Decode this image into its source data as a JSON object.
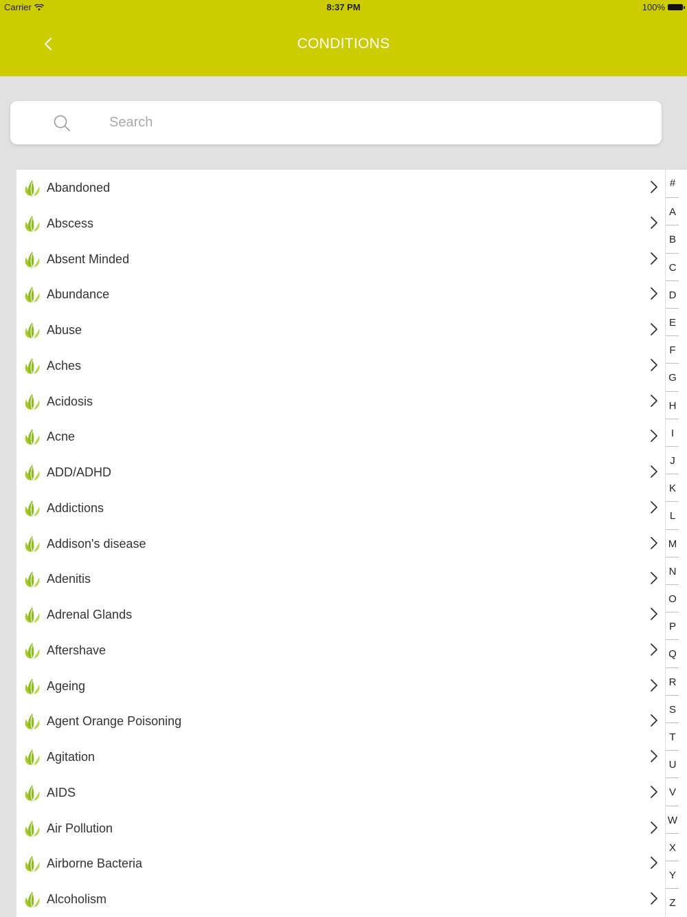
{
  "status_bar": {
    "carrier": "Carrier",
    "time": "8:37 PM",
    "battery": "100%"
  },
  "nav": {
    "title": "CONDITIONS"
  },
  "search": {
    "placeholder": "Search"
  },
  "colors": {
    "brand": "#cccc00",
    "leaf": "#8dbb1d",
    "background": "#e1e1e1"
  },
  "conditions": [
    {
      "label": "Abandoned"
    },
    {
      "label": "Abscess"
    },
    {
      "label": "Absent Minded"
    },
    {
      "label": "Abundance"
    },
    {
      "label": "Abuse"
    },
    {
      "label": "Aches"
    },
    {
      "label": "Acidosis"
    },
    {
      "label": "Acne"
    },
    {
      "label": "ADD/ADHD"
    },
    {
      "label": "Addictions"
    },
    {
      "label": "Addison's disease"
    },
    {
      "label": "Adenitis"
    },
    {
      "label": "Adrenal Glands"
    },
    {
      "label": "Aftershave"
    },
    {
      "label": "Ageing"
    },
    {
      "label": "Agent Orange Poisoning"
    },
    {
      "label": "Agitation"
    },
    {
      "label": "AIDS"
    },
    {
      "label": "Air Pollution"
    },
    {
      "label": "Airborne Bacteria"
    },
    {
      "label": "Alcoholism"
    }
  ],
  "index_letters": [
    "#",
    "A",
    "B",
    "C",
    "D",
    "E",
    "F",
    "G",
    "H",
    "I",
    "J",
    "K",
    "L",
    "M",
    "N",
    "O",
    "P",
    "Q",
    "R",
    "S",
    "T",
    "U",
    "V",
    "W",
    "X",
    "Y",
    "Z"
  ]
}
